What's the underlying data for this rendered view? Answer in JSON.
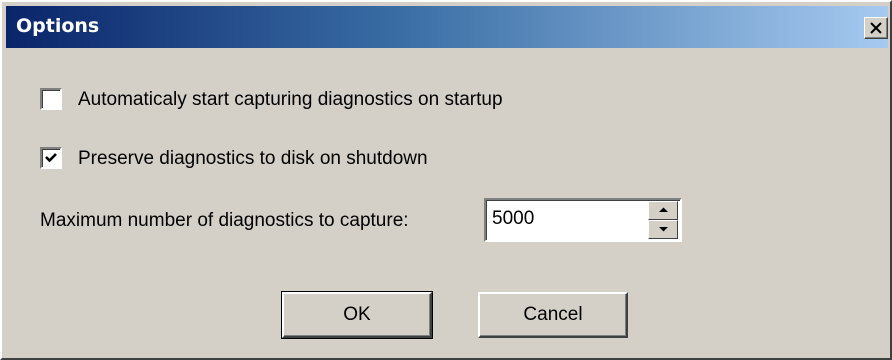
{
  "window": {
    "title": "Options",
    "close_glyph": "X"
  },
  "options": {
    "auto_start": {
      "label": "Automaticaly start capturing diagnostics on startup",
      "checked": false
    },
    "preserve": {
      "label": "Preserve diagnostics to disk on shutdown",
      "checked": true
    },
    "max_count": {
      "label": "Maximum number of diagnostics to capture:",
      "value": "5000"
    }
  },
  "buttons": {
    "ok_label": "OK",
    "cancel_label": "Cancel"
  },
  "icons": {
    "close": "close-icon",
    "check": "checkmark-icon",
    "spin_up": "arrow-up-icon",
    "spin_down": "arrow-down-icon"
  },
  "colors": {
    "title_gradient_start": "#0a246a",
    "title_gradient_end": "#a6caf0",
    "face": "#d4d0c8"
  }
}
